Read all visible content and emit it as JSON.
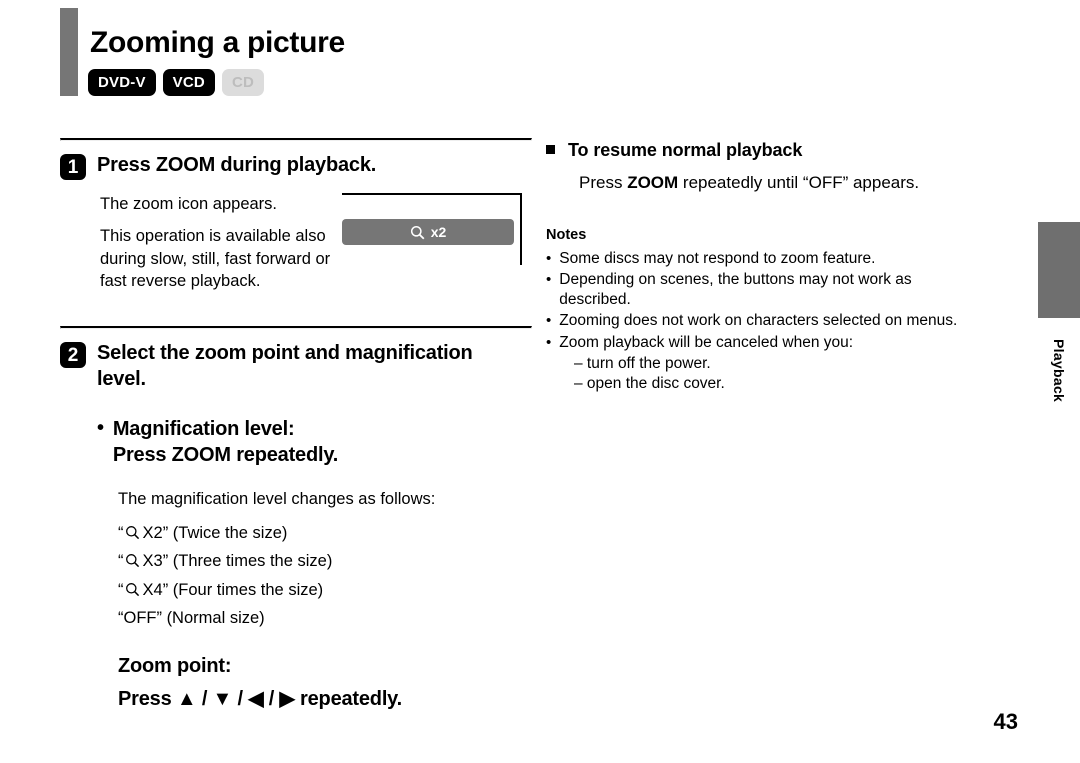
{
  "header": {
    "title": "Zooming a picture",
    "disc_badges": [
      {
        "label": "DVD-V",
        "state": "on"
      },
      {
        "label": "VCD",
        "state": "on"
      },
      {
        "label": "CD",
        "state": "off"
      }
    ]
  },
  "left_column": {
    "step1": {
      "number": "1",
      "title": "Press ZOOM during playback.",
      "paragraphs": [
        "The zoom icon appears.",
        "This operation is available also during slow, still, fast forward or fast reverse playback."
      ],
      "figure": {
        "icon": "magnifier-icon",
        "label": "x2"
      }
    },
    "step2": {
      "number": "2",
      "title": "Select the zoom point and magnification level.",
      "magnification": {
        "bullet": "•",
        "heading_line1": "Magnification level:",
        "heading_line2": "Press ZOOM repeatedly.",
        "intro": "The magnification level changes as follows:",
        "levels": [
          {
            "icon": "magnifier-icon",
            "quote_open": "“",
            "level": "X2",
            "quote_close": "”",
            "desc": "(Twice the size)"
          },
          {
            "icon": "magnifier-icon",
            "quote_open": "“",
            "level": "X3",
            "quote_close": "”",
            "desc": "(Three times the size)"
          },
          {
            "icon": "magnifier-icon",
            "quote_open": "“",
            "level": "X4",
            "quote_close": "”",
            "desc": "(Four times the size)"
          }
        ],
        "off_level": "“OFF” (Normal size)"
      },
      "zoom_point": {
        "heading": "Zoom point:",
        "press_label": "Press",
        "arrows": [
          "▲",
          "▼",
          "◀",
          "▶"
        ],
        "separator": "/",
        "suffix": "repeatedly."
      }
    }
  },
  "right_column": {
    "resume": {
      "bullet": "square-bullet",
      "heading": "To resume normal playback",
      "body_before": "Press ",
      "body_strong": "ZOOM",
      "body_after": " repeatedly until “OFF” appears."
    },
    "notes": {
      "title": "Notes",
      "items": [
        {
          "bullet": "•",
          "text": "Some discs may not respond to zoom feature."
        },
        {
          "bullet": "•",
          "text": "Depending on scenes, the buttons may not work as described."
        },
        {
          "bullet": "•",
          "text": "Zooming does not work on characters selected on menus."
        },
        {
          "bullet": "•",
          "text": "Zoom playback will be canceled when you:"
        }
      ],
      "sub_items": [
        "– turn off the power.",
        "– open the disc cover."
      ]
    }
  },
  "side_tab": {
    "label": "Playback",
    "color": "#6f6f6f"
  },
  "footer": {
    "page_number": "43"
  },
  "colors": {
    "accent_gray": "#767676",
    "badge_on_bg": "#000000",
    "badge_off_bg": "#dcdcdc",
    "badge_off_text": "#bdbdbd"
  }
}
